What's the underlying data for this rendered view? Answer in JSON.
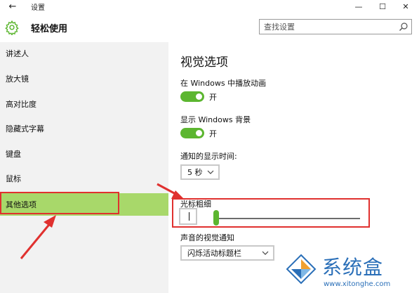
{
  "window": {
    "back_label": "←",
    "title": "设置",
    "minimize_label": "—",
    "maximize_label": "☐",
    "close_label": "✕"
  },
  "header": {
    "app_title": "轻松使用",
    "search_placeholder": "查找设置",
    "gear_icon": "gear-icon",
    "search_icon": "search-icon"
  },
  "sidebar": {
    "items": [
      {
        "label": "讲述人"
      },
      {
        "label": "放大镜"
      },
      {
        "label": "高对比度"
      },
      {
        "label": "隐藏式字幕"
      },
      {
        "label": "键盘"
      },
      {
        "label": "鼠标"
      },
      {
        "label": "其他选项"
      }
    ],
    "active_index": 6
  },
  "main": {
    "section_title": "视觉选项",
    "animations": {
      "label": "在 Windows 中播放动画",
      "state_text": "开",
      "on": true
    },
    "background": {
      "label": "显示 Windows 背景",
      "state_text": "开",
      "on": true
    },
    "notification": {
      "label": "通知的显示时间:",
      "value": "5 秒"
    },
    "cursor": {
      "label": "光标粗细",
      "value_fraction": 0.0
    },
    "visual_alert": {
      "label": "声音的视觉通知",
      "value": "闪烁活动标题栏"
    }
  },
  "colors": {
    "accent": "#5cb630",
    "active_item": "#a8d86a",
    "annotation_red": "#e0312f",
    "watermark_blue": "#2a6fb8"
  },
  "watermark": {
    "name": "系统盒",
    "url": "www.xitonghe.com"
  }
}
